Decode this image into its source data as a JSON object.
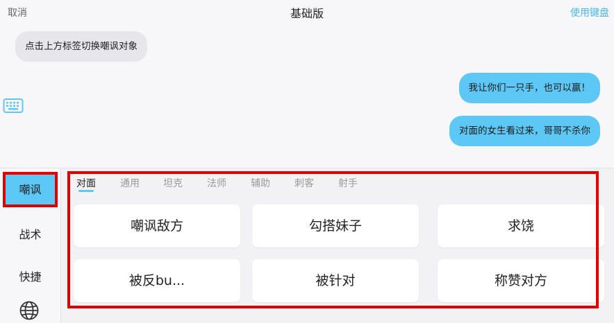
{
  "header": {
    "cancel_label": "取消",
    "title": "基础版",
    "keyboard_label": "使用键盘"
  },
  "chat": {
    "hint_message": "点击上方标签切换嘲讽对象",
    "sent_messages": [
      "我让你们一只手，也可以赢！",
      "对面的女生看过来，哥哥不杀你"
    ]
  },
  "sidebar": {
    "items": [
      {
        "label": "嘲讽",
        "active": true
      },
      {
        "label": "战术"
      },
      {
        "label": "快捷"
      }
    ],
    "bottom_icon": "globe-icon"
  },
  "tabs": [
    "对面",
    "通用",
    "坦克",
    "法师",
    "辅助",
    "刺客",
    "射手"
  ],
  "phrases": [
    "嘲讽敌方",
    "勾搭妹子",
    "求饶",
    "被反bu...",
    "被针对",
    "称赞对方"
  ],
  "colors": {
    "accent": "#5dc8f5",
    "highlight_border": "#e00000",
    "link": "#49b8ef"
  }
}
